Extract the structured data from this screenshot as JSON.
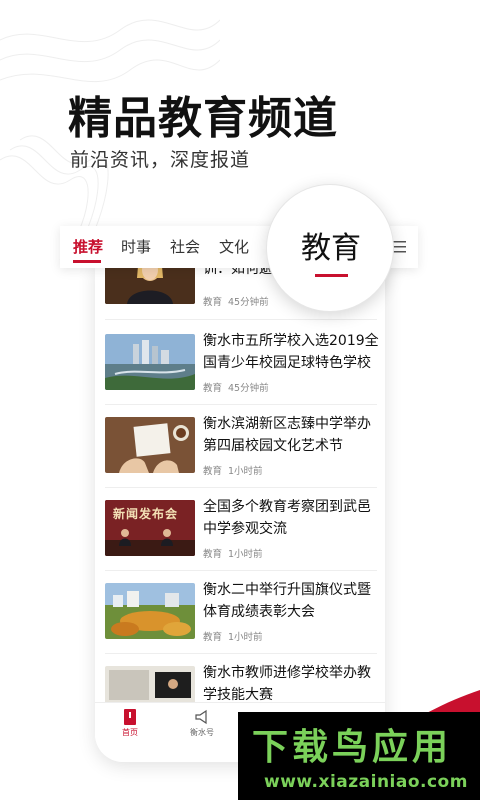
{
  "headline": "精品教育频道",
  "subline": "前沿资讯，深度报道",
  "tabs": [
    {
      "label": "推荐",
      "active": true
    },
    {
      "label": "时事",
      "active": false
    },
    {
      "label": "社会",
      "active": false
    },
    {
      "label": "文化",
      "active": false
    }
  ],
  "lens_label": "教育",
  "menu_icon": "hamburger-menu-icon",
  "feed": [
    {
      "title": "训：如何避",
      "tag": "教育",
      "time": "45分钟前"
    },
    {
      "title": "衡水市五所学校入选2019全国青少年校园足球特色学校",
      "tag": "教育",
      "time": "45分钟前"
    },
    {
      "title": "衡水滨湖新区志臻中学举办第四届校园文化艺术节",
      "tag": "教育",
      "time": "1小时前"
    },
    {
      "title": "全国多个教育考察团到武邑中学参观交流",
      "tag": "教育",
      "time": "1小时前",
      "thumb_text": "新闻发布会"
    },
    {
      "title": "衡水二中举行升国旗仪式暨体育成绩表彰大会",
      "tag": "教育",
      "time": "1小时前"
    },
    {
      "title": "衡水市教师进修学校举办教学技能大赛",
      "tag": "",
      "time": ""
    }
  ],
  "bottom_nav": [
    {
      "label": "首页",
      "icon": "home-icon",
      "active": true
    },
    {
      "label": "衡水号",
      "icon": "megaphone-icon",
      "active": false
    }
  ],
  "watermark": {
    "title": "下载鸟应用",
    "url": "www.xiazainiao.com"
  },
  "colors": {
    "accent": "#c8102e",
    "watermark": "#7bd15a"
  }
}
